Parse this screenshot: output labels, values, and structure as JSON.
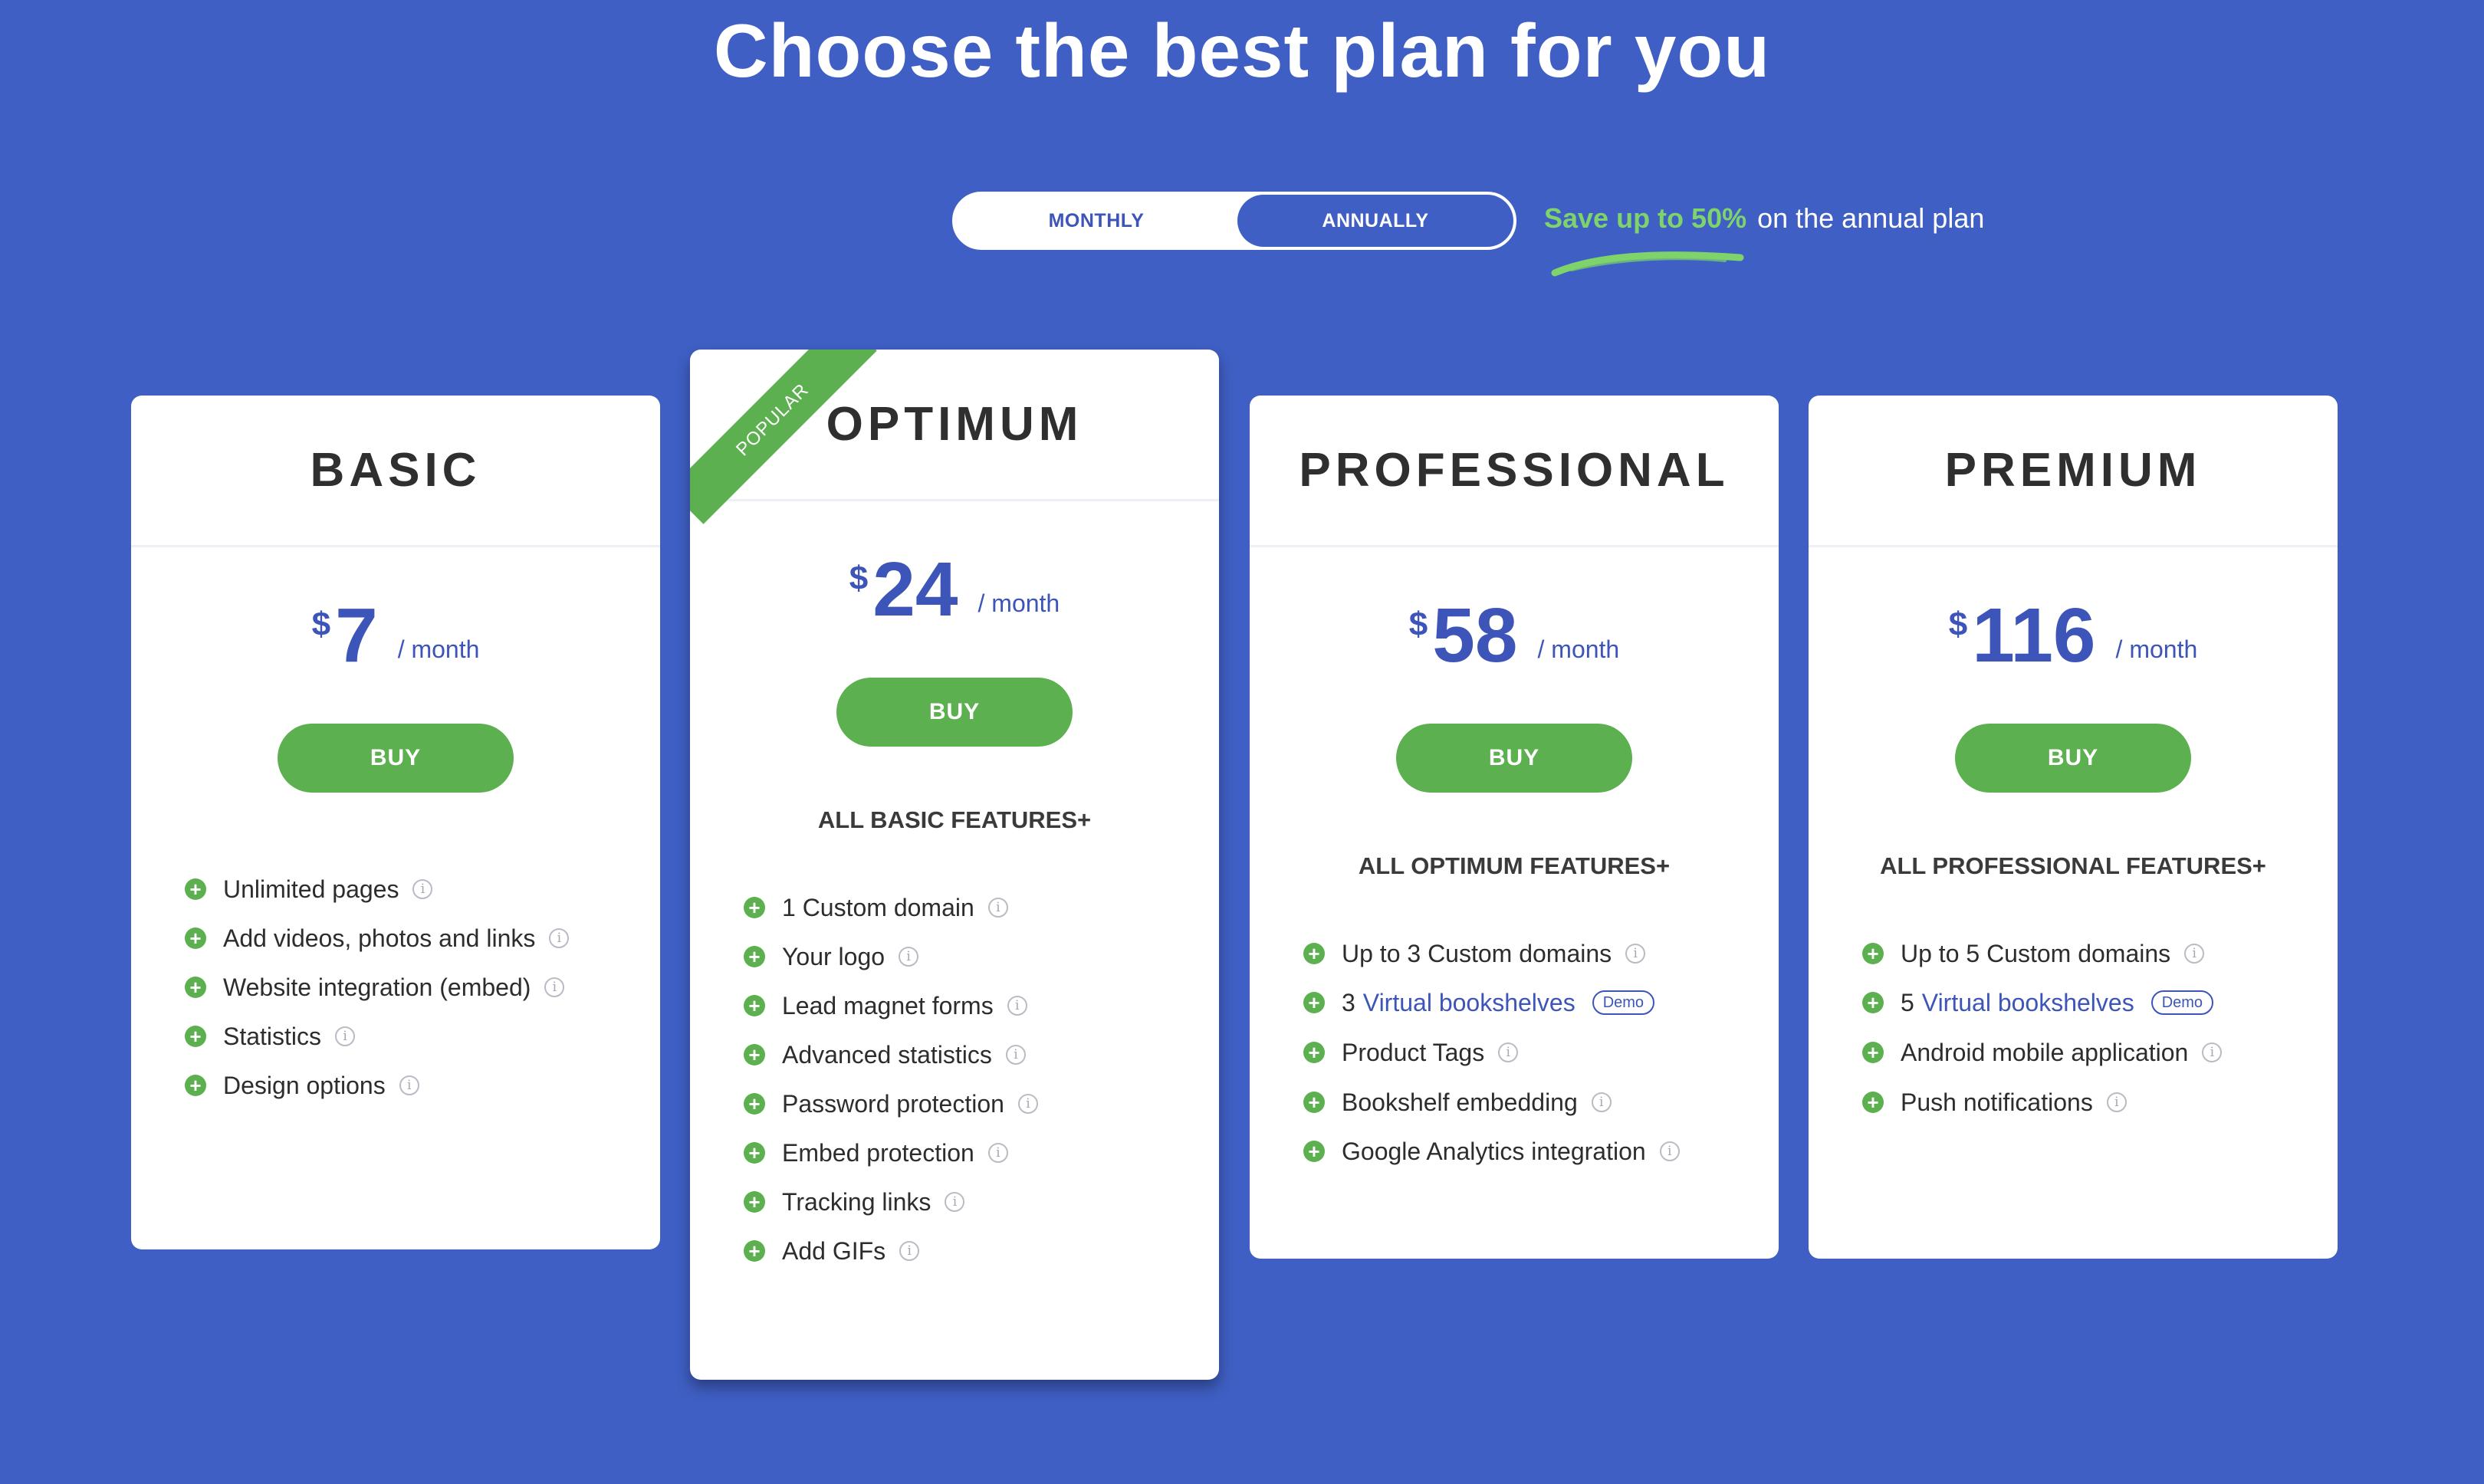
{
  "header": {
    "title": "Choose the best plan for you"
  },
  "billing_toggle": {
    "monthly_label": "MONTHLY",
    "annual_label": "ANNUALLY",
    "selected": "ANNUALLY"
  },
  "savings": {
    "highlight": "Save up to 50%",
    "text": "on the annual plan"
  },
  "colors": {
    "background": "#3f5fc4",
    "accent_blue": "#3d55b8",
    "green": "#5cb04f"
  },
  "plans": [
    {
      "name": "BASIC",
      "currency": "$",
      "price": "7",
      "period": "/ month",
      "buy_label": "BUY",
      "features": [
        {
          "text": "Unlimited pages"
        },
        {
          "text": "Add videos, photos and links"
        },
        {
          "text": "Website integration (embed)"
        },
        {
          "text": "Statistics"
        },
        {
          "text": "Design options"
        }
      ]
    },
    {
      "name": "OPTIMUM",
      "badge": "POPULAR",
      "currency": "$",
      "price": "24",
      "period": "/ month",
      "buy_label": "BUY",
      "inherits": "ALL BASIC FEATURES+",
      "features": [
        {
          "text": "1 Custom domain"
        },
        {
          "text": "Your logo"
        },
        {
          "text": "Lead magnet forms"
        },
        {
          "text": "Advanced statistics"
        },
        {
          "text": "Password protection"
        },
        {
          "text": "Embed protection"
        },
        {
          "text": "Tracking links"
        },
        {
          "text": "Add GIFs"
        }
      ]
    },
    {
      "name": "PROFESSIONAL",
      "currency": "$",
      "price": "58",
      "period": "/ month",
      "buy_label": "BUY",
      "inherits": "ALL OPTIMUM FEATURES+",
      "features": [
        {
          "text": "Up to 3 Custom domains"
        },
        {
          "prefix": "3",
          "link": "Virtual bookshelves",
          "tag": "Demo"
        },
        {
          "text": "Product Tags"
        },
        {
          "text": "Bookshelf embedding"
        },
        {
          "text": "Google Analytics integration"
        }
      ]
    },
    {
      "name": "PREMIUM",
      "currency": "$",
      "price": "116",
      "period": "/ month",
      "buy_label": "BUY",
      "inherits": "ALL PROFESSIONAL FEATURES+",
      "features": [
        {
          "text": "Up to 5 Custom domains"
        },
        {
          "prefix": "5",
          "link": "Virtual bookshelves",
          "tag": "Demo"
        },
        {
          "text": "Android mobile application"
        },
        {
          "text": "Push notifications"
        }
      ]
    }
  ],
  "icons": {
    "feature": "plus-circle-icon",
    "info": "info-icon"
  }
}
